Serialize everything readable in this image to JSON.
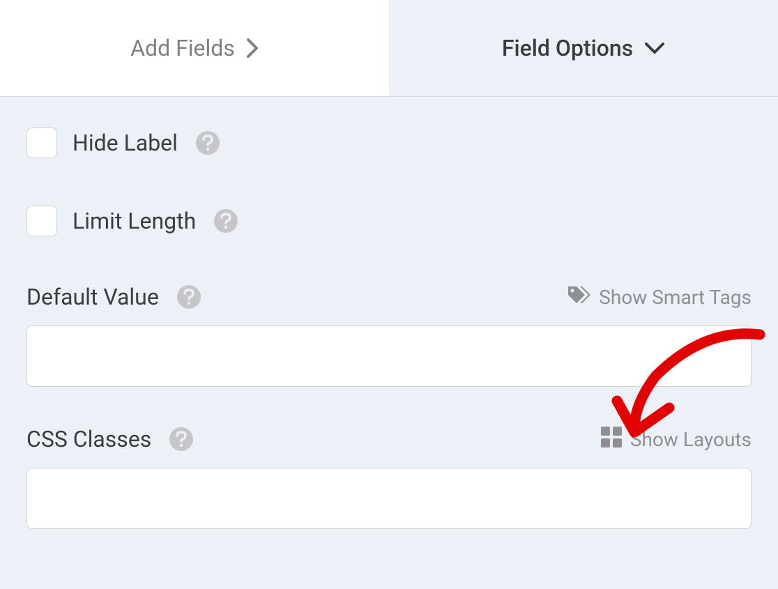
{
  "tabs": {
    "add_fields": "Add Fields",
    "field_options": "Field Options"
  },
  "options": {
    "hide_label": "Hide Label",
    "limit_length": "Limit Length"
  },
  "sections": {
    "default_value": {
      "label": "Default Value",
      "action_label": "Show Smart Tags",
      "value": ""
    },
    "css_classes": {
      "label": "CSS Classes",
      "action_label": "Show Layouts",
      "value": ""
    }
  }
}
